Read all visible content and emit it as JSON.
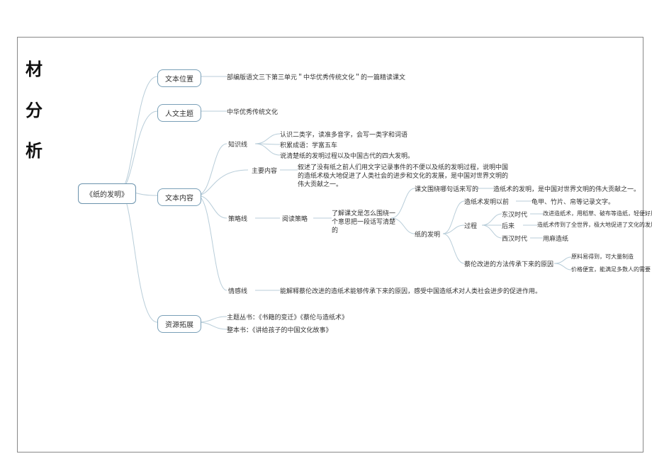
{
  "title_chars": [
    "材",
    "分",
    "析"
  ],
  "root": "《纸的发明》",
  "b1": "文本位置",
  "b1_leaf": "部编版语文三下第三单元＂中华优秀传统文化＂的一篇精读课文",
  "b2": "人文主题",
  "b2_leaf": "中华优秀传统文化",
  "b3": "文本内容",
  "b3_1": "知识线",
  "b3_1_a": "认识二类字，读准多音字，会写一类字和词语",
  "b3_1_b": "积累成语：学富五车",
  "b3_1_c": "说清楚纸的发明过程以及中国古代的四大发明。",
  "b3_2": "主要内容",
  "b3_2_leaf": "叙述了没有纸之前人们用文字记录事件的不便以及纸的发明过程，说明中国的造纸术极大地促进了人类社会的进步和文化的发展，是中国对世界文明的伟大贡献之一。",
  "b3_3": "策略线",
  "b3_3_1": "阅读策略",
  "b3_3_1_leaf": "了解课文是怎么围绕一个意思把一段话写清楚的",
  "b3_3_r1": "课文围绕哪句话来写的",
  "b3_3_r1v": "造纸术的发明，是中国对世界文明的伟大贡献之一。",
  "b3_3_r2": "纸的发明",
  "b3_3_r2a": "造纸术发明以前",
  "b3_3_r2a_v": "龟甲、竹片、帛等记录文字。",
  "b3_3_r2b": "过程",
  "b3_3_r2b_1k": "东汉时代",
  "b3_3_r2b_1v": "改进造纸术，用稻草、破布等造纸，轻便好用。",
  "b3_3_r2b_2k": "后来",
  "b3_3_r2b_2v": "造纸术传到了全世界，极大地促进了文化的发展。",
  "b3_3_r2b_3k": "西汉时代",
  "b3_3_r2b_3v": "用麻造纸",
  "b3_3_r2c": "蔡伦改进的方法传承下来的原因",
  "b3_3_r2c_1": "原料易得到，可大量制造",
  "b3_3_r2c_2": "价格便宜，能满足多数人的需要",
  "b3_4": "情感线",
  "b3_4_leaf": "能解释蔡伦改进的造纸术能够传承下来的原因，感受中国造纸术对人类社会进步的促进作用。",
  "b4": "资源拓展",
  "b4_a": "主题丛书：《书籍的变迁》《蔡伦与造纸术》",
  "b4_b": "整本书：《讲给孩子的中国文化故事》"
}
